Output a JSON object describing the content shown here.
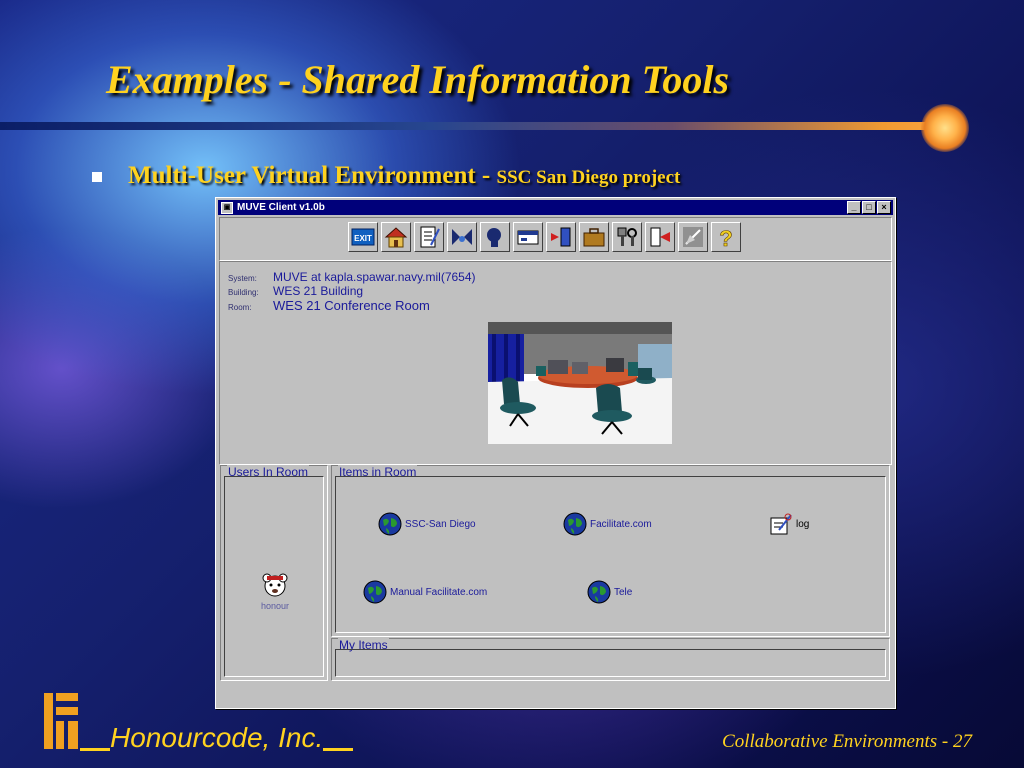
{
  "slide": {
    "title": "Examples - Shared Information Tools",
    "bullet_main": "Multi-User Virtual Environment - ",
    "bullet_sub": "SSC San Diego project",
    "company": "Honourcode, Inc.",
    "footer": "Collaborative Environments - 27"
  },
  "window": {
    "title": "MUVE Client v1.0b",
    "controls": [
      "_",
      "□",
      "×"
    ],
    "toolbar_icons": [
      "exit-icon",
      "home-icon",
      "notes-icon",
      "people-icon",
      "head-icon",
      "card-icon",
      "door-in-icon",
      "briefcase-icon",
      "tools-icon",
      "door-out-icon",
      "edit-icon",
      "help-icon"
    ],
    "exit_label": "EXIT",
    "help_label": "?"
  },
  "info": {
    "system_label": "System:",
    "system_value": "MUVE at kapla.spawar.navy.mil(7654)",
    "building_label": "Building:",
    "building_value": "WES 21 Building",
    "room_label": "Room:",
    "room_value": "WES 21 Conference Room"
  },
  "users": {
    "legend": "Users In Room",
    "list": [
      {
        "name": "honour"
      }
    ]
  },
  "items": {
    "legend": "Items in Room",
    "list": [
      {
        "label": "SSC-San Diego",
        "icon": "globe-icon"
      },
      {
        "label": "Facilitate.com",
        "icon": "globe-icon"
      },
      {
        "label": "log",
        "icon": "notepad-icon"
      },
      {
        "label": "Manual Facilitate.com",
        "icon": "globe-icon"
      },
      {
        "label": "Tele",
        "icon": "globe-icon"
      }
    ]
  },
  "my_items": {
    "legend": "My Items"
  },
  "colors": {
    "slide_text": "#ffd21f",
    "window_title_bar": "#00007a",
    "window_face": "#c0c0c0",
    "label_blue": "#1a1a9a"
  }
}
